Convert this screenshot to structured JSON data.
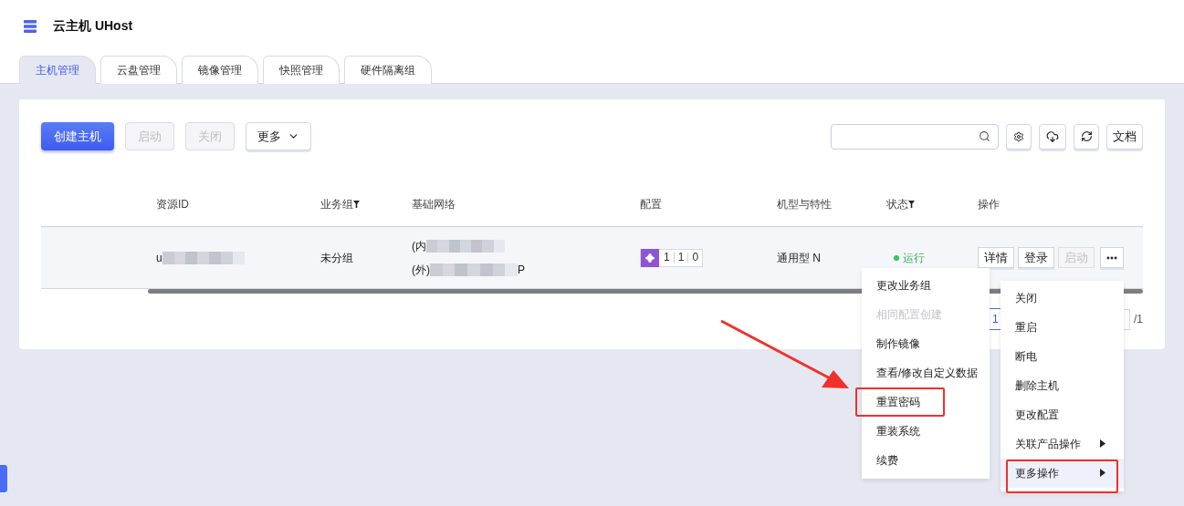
{
  "header": {
    "title": "云主机 UHost"
  },
  "tabs": [
    {
      "label": "主机管理",
      "selected": true
    },
    {
      "label": "云盘管理",
      "selected": false
    },
    {
      "label": "镜像管理",
      "selected": false
    },
    {
      "label": "快照管理",
      "selected": false
    },
    {
      "label": "硬件隔离组",
      "selected": false
    }
  ],
  "toolbar": {
    "buttons": [
      {
        "label": "创建主机",
        "kind": "primary",
        "disabled": false
      },
      {
        "label": "启动",
        "kind": "plain",
        "disabled": true
      },
      {
        "label": "关闭",
        "kind": "plain",
        "disabled": true
      },
      {
        "label": "更多",
        "kind": "dropdown",
        "disabled": false
      }
    ],
    "tools": [
      {
        "kind": "settings"
      },
      {
        "kind": "download"
      },
      {
        "kind": "refresh"
      },
      {
        "kind": "text",
        "label": "文档"
      }
    ]
  },
  "table": {
    "columns": [
      {
        "label": "资源ID",
        "filter": false
      },
      {
        "label": "业务组",
        "filter": true
      },
      {
        "label": "基础网络",
        "filter": false
      },
      {
        "label": "配置",
        "filter": false
      },
      {
        "label": "机型与特性",
        "filter": false
      },
      {
        "label": "状态",
        "filter": true
      },
      {
        "label": "操作",
        "filter": false
      }
    ],
    "rows": [
      {
        "resource_id": "u",
        "group": "未分组",
        "network": [
          {
            "prefix": "(内"
          },
          {
            "prefix": "(外)",
            "suffix": "P"
          }
        ],
        "config": [
          "1",
          "1",
          "0"
        ],
        "type": "通用型 N",
        "status": {
          "label": "运行",
          "color": "#34c759"
        },
        "actions": [
          {
            "kind": "text",
            "label": "详情",
            "disabled": false
          },
          {
            "kind": "text",
            "label": "登录",
            "disabled": false
          },
          {
            "kind": "text",
            "label": "启动",
            "disabled": true
          },
          {
            "kind": "more"
          }
        ]
      }
    ]
  },
  "pagination": {
    "current": "1",
    "total": "/1"
  },
  "menus": [
    {
      "items": [
        {
          "label": "更改业务组",
          "disabled": false,
          "submenu": false,
          "selected": false,
          "annotated": false
        },
        {
          "label": "相同配置创建",
          "disabled": true,
          "submenu": false,
          "selected": false,
          "annotated": false
        },
        {
          "label": "制作镜像",
          "disabled": false,
          "submenu": false,
          "selected": false,
          "annotated": false
        },
        {
          "label": "查看/修改自定义数据",
          "disabled": false,
          "submenu": false,
          "selected": false,
          "annotated": false
        },
        {
          "label": "重置密码",
          "disabled": false,
          "submenu": false,
          "selected": false,
          "annotated": true
        },
        {
          "label": "重装系统",
          "disabled": false,
          "submenu": false,
          "selected": false,
          "annotated": false
        },
        {
          "label": "续费",
          "disabled": false,
          "submenu": false,
          "selected": false,
          "annotated": false
        }
      ]
    },
    {
      "items": [
        {
          "label": "关闭",
          "disabled": false,
          "submenu": false,
          "selected": false,
          "annotated": false
        },
        {
          "label": "重启",
          "disabled": false,
          "submenu": false,
          "selected": false,
          "annotated": false
        },
        {
          "label": "断电",
          "disabled": false,
          "submenu": false,
          "selected": false,
          "annotated": false
        },
        {
          "label": "删除主机",
          "disabled": false,
          "submenu": false,
          "selected": false,
          "annotated": false
        },
        {
          "label": "更改配置",
          "disabled": false,
          "submenu": false,
          "selected": false,
          "annotated": false
        },
        {
          "label": "关联产品操作",
          "disabled": false,
          "submenu": true,
          "selected": false,
          "annotated": false
        },
        {
          "label": "更多操作",
          "disabled": false,
          "submenu": true,
          "selected": true,
          "annotated": true
        }
      ]
    }
  ]
}
